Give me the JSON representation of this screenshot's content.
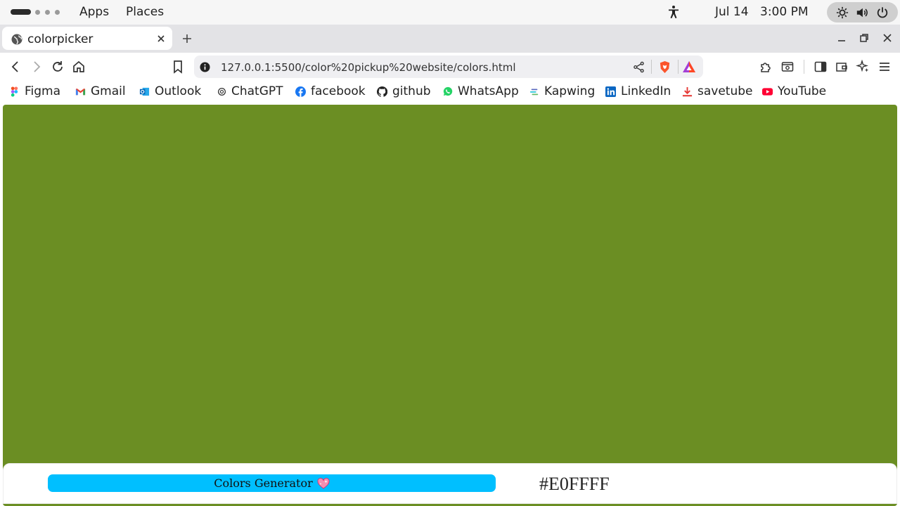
{
  "topbar": {
    "menus": [
      "Apps",
      "Places"
    ],
    "date": "Jul 14",
    "time": "3:00 PM"
  },
  "tab": {
    "title": "colorpicker",
    "favicon": "globe-icon"
  },
  "toolbar": {
    "url": "127.0.0.1:5500/color%20pickup%20website/colors.html"
  },
  "bookmarks": [
    {
      "label": "Figma",
      "icon": "figma-icon"
    },
    {
      "label": "Gmail",
      "icon": "gmail-icon"
    },
    {
      "label": "Outlook",
      "icon": "outlook-icon"
    },
    {
      "label": "ChatGPT",
      "icon": "chatgpt-icon"
    },
    {
      "label": "facebook",
      "icon": "facebook-icon"
    },
    {
      "label": "github",
      "icon": "github-icon"
    },
    {
      "label": "WhatsApp",
      "icon": "whatsapp-icon"
    },
    {
      "label": "Kapwing",
      "icon": "kapwing-icon"
    },
    {
      "label": "LinkedIn",
      "icon": "linkedin-icon"
    },
    {
      "label": "savetube",
      "icon": "download-icon"
    },
    {
      "label": "YouTube",
      "icon": "youtube-icon"
    }
  ],
  "page": {
    "background_color": "#6B8E23",
    "button_label": "Colors Generator",
    "button_color": "#00BFFF",
    "hex_value": "#E0FFFF"
  }
}
